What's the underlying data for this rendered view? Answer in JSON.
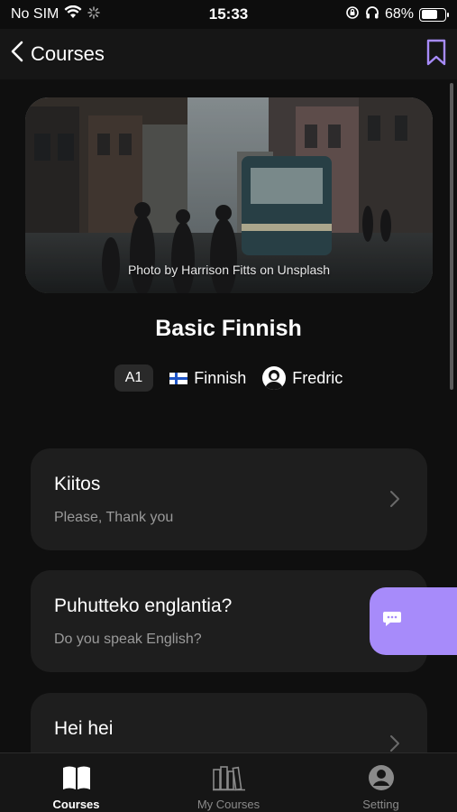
{
  "status_bar": {
    "carrier": "No SIM",
    "time": "15:33",
    "battery": "68%",
    "battery_level": 0.68
  },
  "nav": {
    "back_label": "Courses",
    "bookmark_icon": "bookmark-icon",
    "accent_color": "#a78bfa"
  },
  "hero": {
    "credit": "Photo by Harrison Fitts on Unsplash"
  },
  "course": {
    "title": "Basic Finnish",
    "level": "A1",
    "language": "Finnish",
    "author": "Fredric"
  },
  "lessons": [
    {
      "title": "Kiitos",
      "subtitle": "Please, Thank you"
    },
    {
      "title": "Puhutteko englantia?",
      "subtitle": "Do you speak English?"
    },
    {
      "title": "Hei hei",
      "subtitle": ""
    }
  ],
  "tabs": [
    {
      "label": "Courses",
      "icon": "open-book-icon",
      "active": true
    },
    {
      "label": "My Courses",
      "icon": "bookshelf-icon",
      "active": false
    },
    {
      "label": "Setting",
      "icon": "profile-icon",
      "active": false
    }
  ]
}
